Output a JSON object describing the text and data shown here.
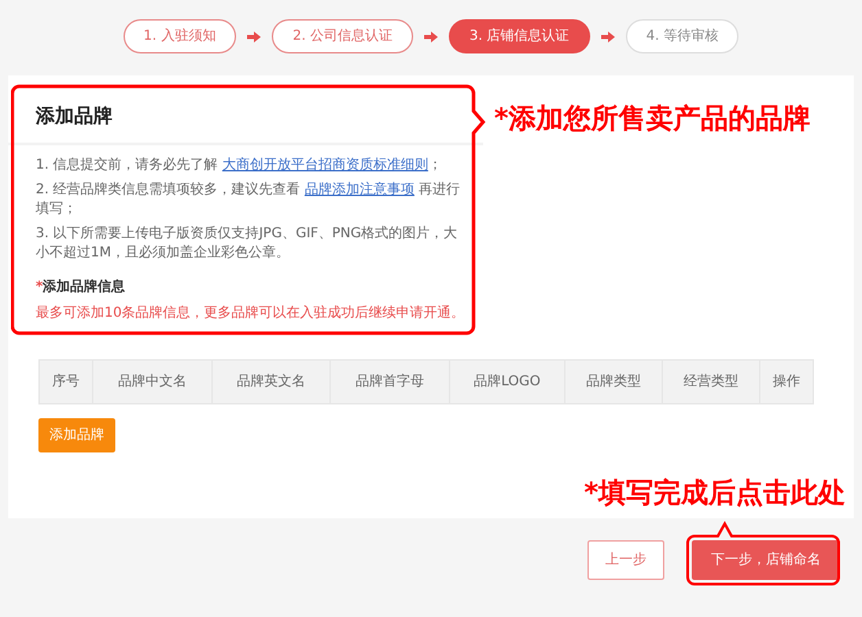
{
  "steps": [
    {
      "label": "1. 入驻须知",
      "kind": "done"
    },
    {
      "label": "2. 公司信息认证",
      "kind": "done"
    },
    {
      "label": "3. 店铺信息认证",
      "kind": "current"
    },
    {
      "label": "4. 等待审核",
      "kind": "pending"
    }
  ],
  "panel": {
    "title": "添加品牌",
    "notes": [
      [
        {
          "kind": "text",
          "text": "1. 信息提交前，请务必先了解 "
        },
        {
          "kind": "link",
          "text": "大商创开放平台招商资质标准细则"
        },
        {
          "kind": "text",
          "text": "；"
        }
      ],
      [
        {
          "kind": "text",
          "text": "2. 经营品牌类信息需填项较多，建议先查看 "
        },
        {
          "kind": "link",
          "text": "品牌添加注意事项"
        },
        {
          "kind": "text",
          "text": " 再进行填写；"
        }
      ],
      [
        {
          "kind": "text",
          "text": "3. 以下所需要上传电子版资质仅支持JPG、GIF、PNG格式的图片，大小不超过1M，且必须加盖企业彩色公章。"
        }
      ]
    ],
    "section_mark": "*",
    "section_title": "添加品牌信息",
    "hint": "最多可添加10条品牌信息，更多品牌可以在入驻成功后继续申请开通。"
  },
  "table": {
    "columns": [
      "序号",
      "品牌中文名",
      "品牌英文名",
      "品牌首字母",
      "品牌LOGO",
      "品牌类型",
      "经营类型",
      "操作"
    ]
  },
  "add_button": "添加品牌",
  "annotations": [
    "*添加您所售卖产品的品牌",
    "*填写完成后点击此处"
  ],
  "buttons": {
    "prev": "上一步",
    "next": "下一步，店铺命名"
  }
}
